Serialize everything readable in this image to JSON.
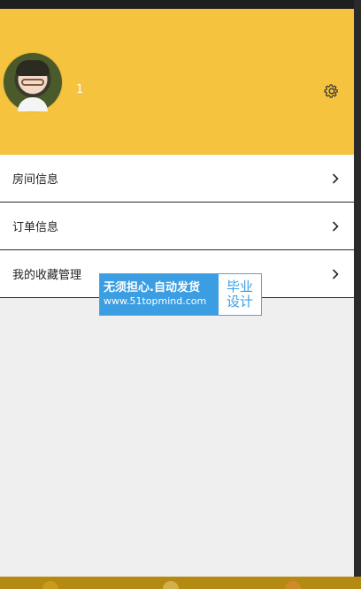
{
  "profile": {
    "username": "1",
    "avatar_icon": "avatar",
    "settings_icon": "gear-icon"
  },
  "menu": {
    "items": [
      {
        "label": "房间信息",
        "icon": "chevron-right-icon"
      },
      {
        "label": "订单信息",
        "icon": "chevron-right-icon"
      },
      {
        "label": "我的收藏管理",
        "icon": "chevron-right-icon"
      }
    ]
  },
  "watermark": {
    "line1": "无须担心.自动发货",
    "line2": "www.51topmind.com",
    "right_line1": "毕业",
    "right_line2": "设计"
  },
  "colors": {
    "header": "#f6c33f",
    "background": "#efefef",
    "bottom_bar": "#b58a12"
  }
}
